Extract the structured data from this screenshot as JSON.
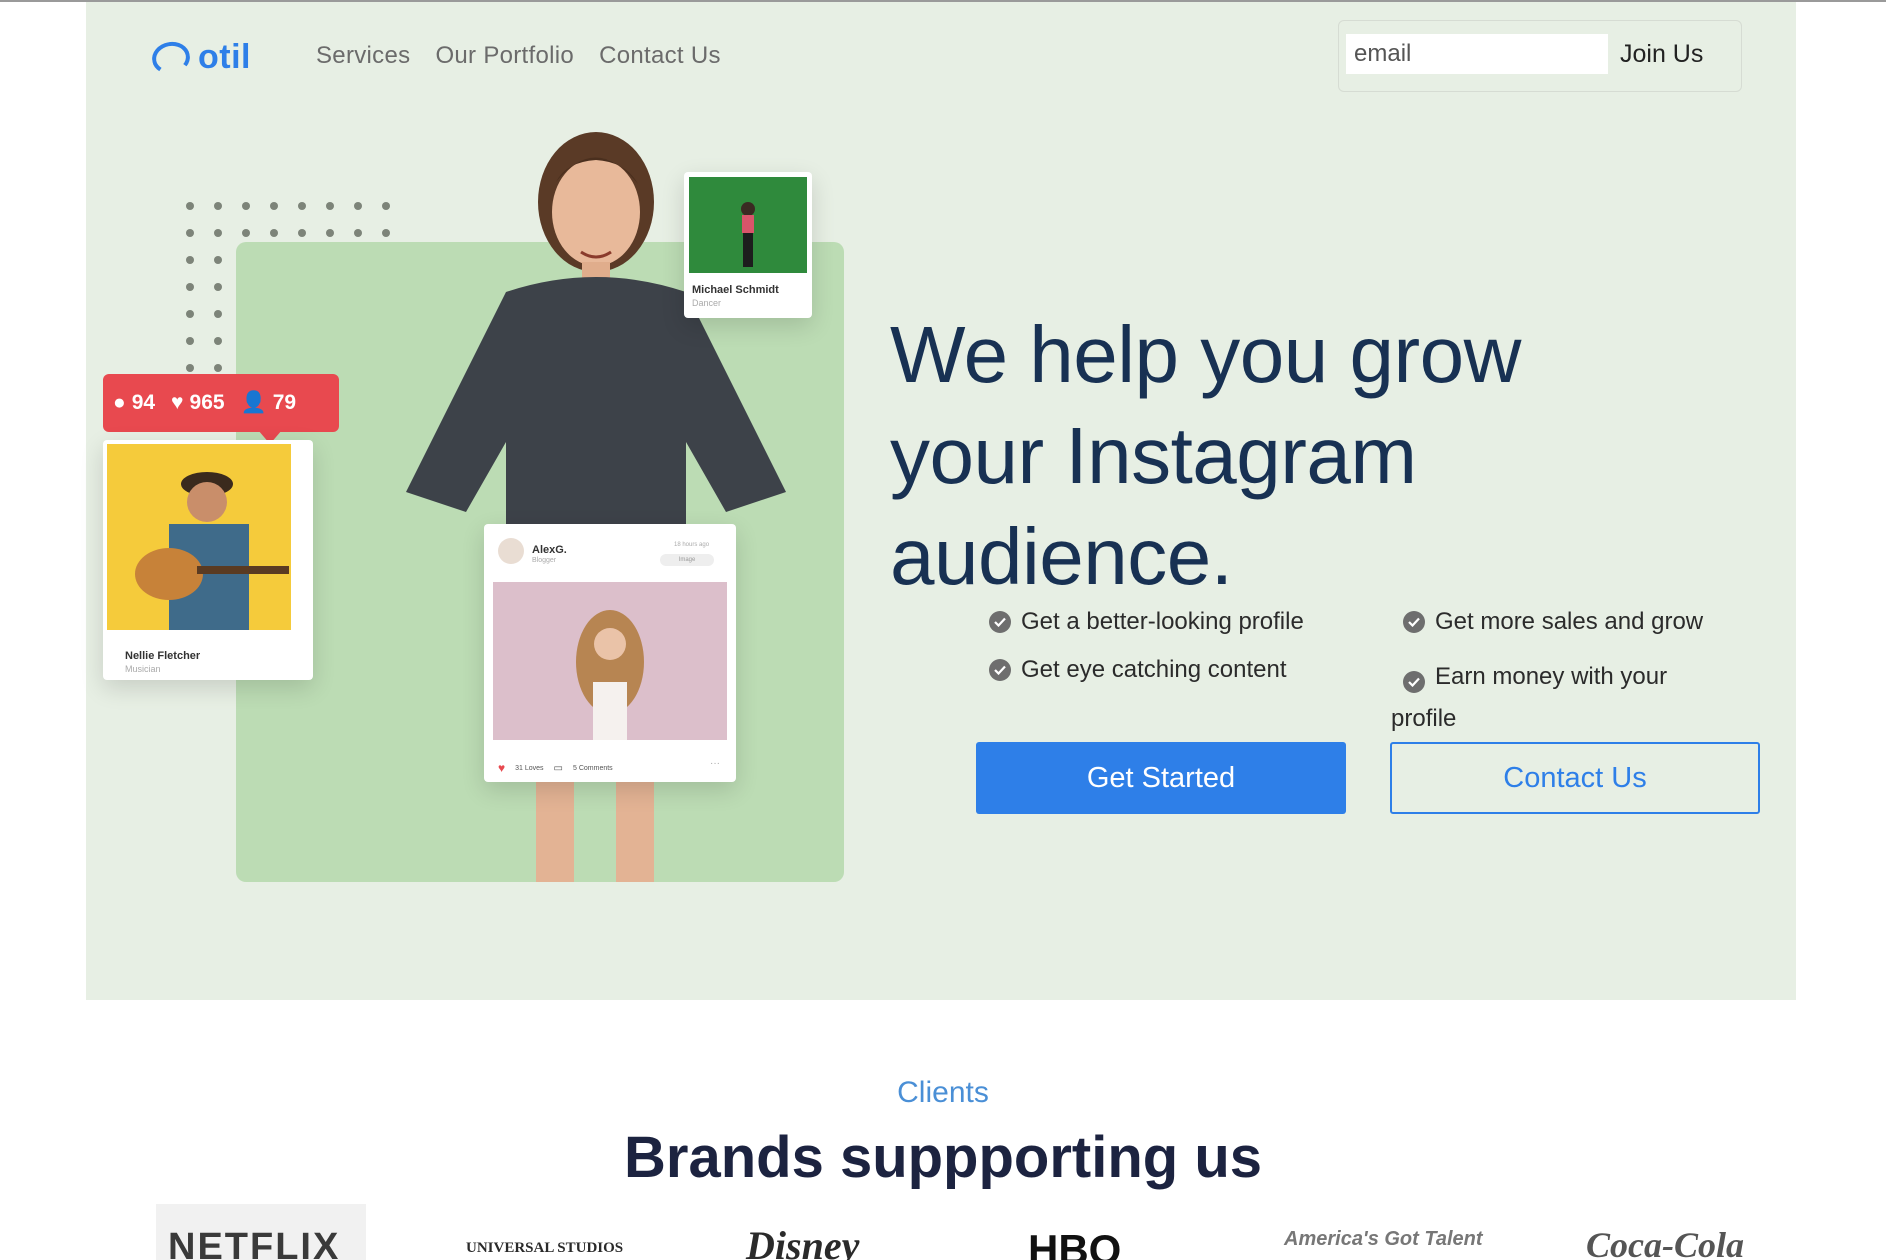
{
  "nav": {
    "logo_text": "otil",
    "links": [
      "Services",
      "Our Portfolio",
      "Contact Us"
    ],
    "email_placeholder": "email",
    "join_label": "Join Us"
  },
  "hero": {
    "headline": "We help you grow your Instagram audience.",
    "features": [
      "Get a better-looking profile",
      "Get more sales and grow",
      "Get eye catching content",
      "Earn money with your profile"
    ],
    "primary_cta": "Get Started",
    "secondary_cta": "Contact Us"
  },
  "illustration": {
    "stats": {
      "comments": "94",
      "likes": "965",
      "followers": "79"
    },
    "card_dancer": {
      "name": "Michael Schmidt",
      "role": "Dancer"
    },
    "card_musician": {
      "name": "Nellie Fletcher",
      "role": "Musician"
    },
    "card_post": {
      "name": "AlexG.",
      "role": "Blogger",
      "time": "18 hours ago",
      "tag": "Image",
      "loves": "31 Loves",
      "comments": "5 Comments"
    }
  },
  "clients": {
    "label": "Clients",
    "title": "Brands suppporting us",
    "brands": [
      "NETFLIX",
      "UNIVERSAL STUDIOS",
      "Disney",
      "HBO",
      "America's Got Talent",
      "Coca-Cola"
    ]
  },
  "colors": {
    "accent": "#2e7fe8",
    "hero_bg": "#e7efe4",
    "headline": "#183153",
    "stats": "#e8494f"
  }
}
